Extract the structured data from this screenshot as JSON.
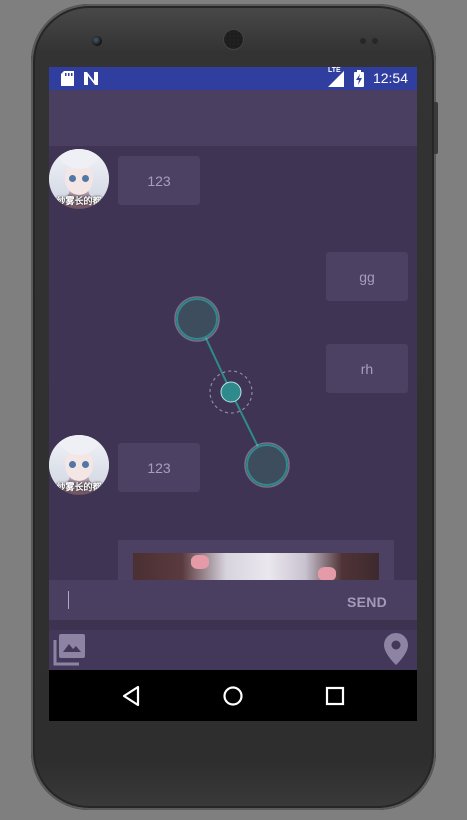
{
  "status_bar": {
    "time": "12:54",
    "network_label": "LTE",
    "icons": [
      "sd-card-icon",
      "n-notification-icon",
      "signal-icon",
      "battery-charging-icon"
    ]
  },
  "messages": [
    {
      "side": "left",
      "type": "text",
      "text": "123",
      "avatar_caption": "纱雾长的都"
    },
    {
      "side": "right",
      "type": "text",
      "text": "gg"
    },
    {
      "side": "right",
      "type": "text",
      "text": "rh"
    },
    {
      "side": "left",
      "type": "text",
      "text": "123",
      "avatar_caption": "纱雾长的都"
    },
    {
      "side": "right",
      "type": "image"
    }
  ],
  "composer": {
    "input_value": "",
    "send_label": "SEND"
  },
  "toolbar": {
    "left_icon": "gallery-icon",
    "right_icon": "location-pin-icon"
  },
  "nav": {
    "icons": [
      "back-icon",
      "home-icon",
      "recents-icon"
    ]
  },
  "colors": {
    "status_bar": "#303f9f",
    "background": "#3f3453",
    "bubble": "#4c4163",
    "overlay_accent": "#2f8a8c"
  }
}
